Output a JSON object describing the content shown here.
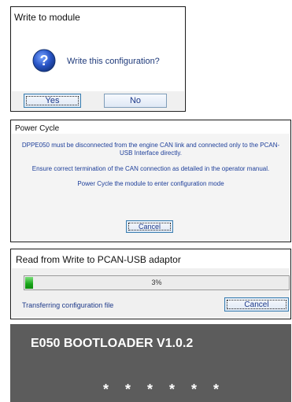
{
  "confirm_dialog": {
    "title": "Write to module",
    "icon": "question-icon",
    "message": "Write this configuration?",
    "yes_label": "Yes",
    "no_label": "No"
  },
  "power_cycle_dialog": {
    "title": "Power Cycle",
    "message_1": "DPPE050 must be disconnected from the engine CAN link and connected only to the PCAN-USB Interface directly.",
    "message_2": "Ensure correct termination of the CAN connection as detailed in the operator manual.",
    "message_3": "Power Cycle the module to enter configuration mode",
    "cancel_label": "Cancel"
  },
  "progress_dialog": {
    "title": "Read from Write to PCAN-USB adaptor",
    "progress_percent": 3,
    "progress_text": "3%",
    "status": "Transferring configuration file",
    "cancel_label": "Cancel"
  },
  "bootloader": {
    "title": "E050  BOOTLOADER V1.0.2",
    "stars": "* * * * * *"
  },
  "colors": {
    "text_blue": "#1e3a8a",
    "progress_green": "#19a519",
    "boot_bg": "#5c5c5c"
  }
}
